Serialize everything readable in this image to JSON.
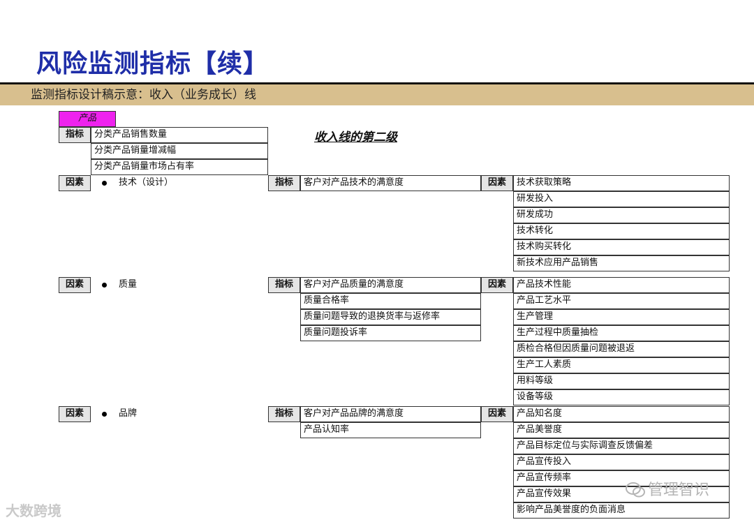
{
  "title": "风险监测指标【续】",
  "band_text": "监测指标设计稿示意：收入（业务成长）线",
  "level_title": "收入线的第二级",
  "product_label": "产品",
  "label_indicator": "指标",
  "label_factor": "因素",
  "top_indicators": [
    "分类产品销售数量",
    "分类产品销量增减幅",
    "分类产品销量市场占有率"
  ],
  "groups": [
    {
      "factor": "技术（设计）",
      "indicators": [
        "客户对产品技术的满意度"
      ],
      "factors": [
        "技术获取策略",
        "研发投入",
        "研发成功",
        "技术转化",
        "技术购买转化",
        "新技术应用产品销售"
      ]
    },
    {
      "factor": "质量",
      "indicators": [
        "客户对产品质量的满意度",
        "质量合格率",
        "质量问题导致的退换货率与返修率",
        "质量问题投诉率"
      ],
      "factors": [
        "产品技术性能",
        "产品工艺水平",
        "生产管理",
        "生产过程中质量抽检",
        "质检合格但因质量问题被退返",
        "生产工人素质",
        "用料等级",
        "设备等级"
      ]
    },
    {
      "factor": "品牌",
      "indicators": [
        "客户对产品品牌的满意度",
        "产品认知率"
      ],
      "factors": [
        "产品知名度",
        "产品美誉度",
        "产品目标定位与实际调查反馈偏差",
        "产品宣传投入",
        "产品宣传频率",
        "产品宣传效果",
        "影响产品美誉度的负面消息"
      ]
    }
  ],
  "watermark_left": "大数跨境",
  "watermark_right": "管理智识"
}
